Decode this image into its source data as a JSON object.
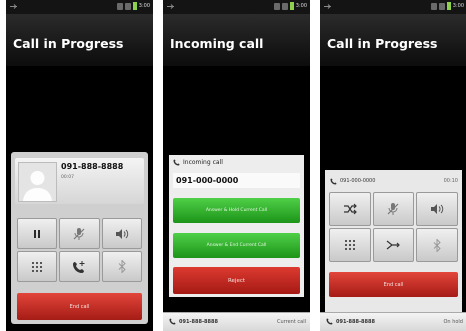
{
  "screens": [
    {
      "title": "Call in Progress",
      "status_time": "3:00",
      "contact_number": "091-888-8888",
      "call_duration": "00:07",
      "buttons": [
        "hold",
        "mute",
        "speaker",
        "dialpad",
        "add-call",
        "bluetooth"
      ],
      "end_call_label": "End call"
    },
    {
      "title": "Incoming call",
      "status_time": "3:00",
      "incoming_label": "Incoming call",
      "incoming_number": "091-000-0000",
      "answer_hold_label": "Answer & Hold Current Call",
      "answer_end_label": "Answer & End Current Call",
      "reject_label": "Reject",
      "current_number": "091-888-8888",
      "current_status": "Current call"
    },
    {
      "title": "Call in Progress",
      "status_time": "3:00",
      "active_number": "091-000-0000",
      "active_duration": "00:10",
      "buttons": [
        "swap-calls",
        "mute",
        "speaker",
        "dialpad",
        "merge-calls",
        "bluetooth"
      ],
      "end_call_label": "End call",
      "held_number": "091-888-8888",
      "held_status": "On hold"
    }
  ],
  "colors": {
    "background": "#000000",
    "end_call": "#c8281f",
    "answer": "#35b22f",
    "panel": "#cfcfcf"
  }
}
